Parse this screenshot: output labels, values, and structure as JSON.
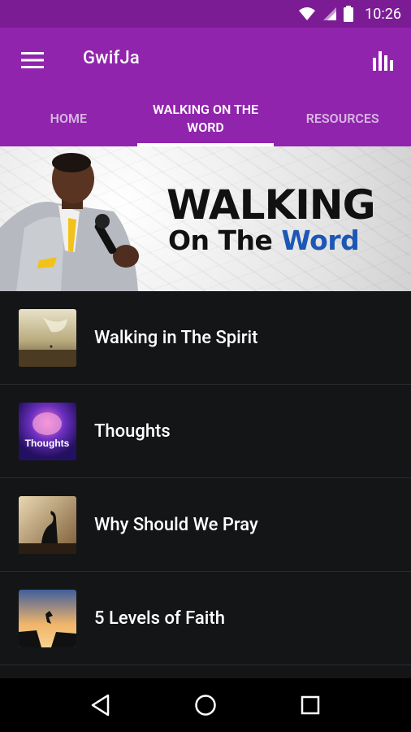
{
  "status": {
    "time": "10:26"
  },
  "app": {
    "title": "GwifJa"
  },
  "tabs": [
    {
      "label": "HOME",
      "active": false
    },
    {
      "label": "WALKING ON THE WORD",
      "active": true
    },
    {
      "label": "RESOURCES",
      "active": false
    }
  ],
  "banner": {
    "line1": "WALKING",
    "line2_a": "On The ",
    "line2_b": "Word"
  },
  "items": [
    {
      "label": "Walking in The Spirit"
    },
    {
      "label": "Thoughts",
      "thumb_text": "Thoughts"
    },
    {
      "label": "Why Should We Pray"
    },
    {
      "label": "5 Levels of Faith"
    }
  ],
  "colors": {
    "appbar": "#9124ad",
    "statusbar": "#7b1c95",
    "list_bg": "#141517"
  }
}
